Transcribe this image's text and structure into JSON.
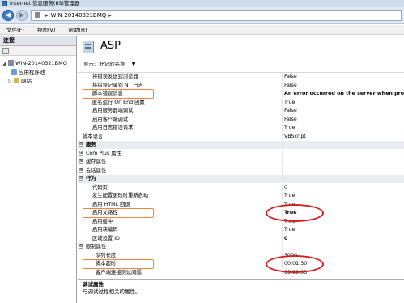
{
  "window": {
    "title": "Internet 信息服务(IIS)管理器"
  },
  "address": {
    "server": "WIN-20140321BMQ",
    "separator": "▸"
  },
  "menu": {
    "items": [
      "文件(F)",
      "视图(V)",
      "帮助(H)"
    ]
  },
  "connections": {
    "header": "连接",
    "tree": {
      "server": "WIN-20140321BMQ",
      "children": [
        "应用程序池",
        "网站"
      ]
    }
  },
  "main": {
    "title": "ASP",
    "display_label": "显示:",
    "display_value": "好记的名称"
  },
  "grid": {
    "rows": [
      {
        "name": "将错误发送到浏览器",
        "value": "False",
        "kind": "child"
      },
      {
        "name": "将错误记录到 NT 日志",
        "value": "False",
        "kind": "child"
      },
      {
        "name": "脚本错误消息",
        "value": "An error occurred on the server when proce",
        "kind": "child",
        "bold": true
      },
      {
        "name": "匿名运行 On End 函数",
        "value": "True",
        "kind": "child"
      },
      {
        "name": "启用服务器端调试",
        "value": "False",
        "kind": "child"
      },
      {
        "name": "启用客户端调试",
        "value": "False",
        "kind": "child"
      },
      {
        "name": "启用日志错误请求",
        "value": "True",
        "kind": "child"
      },
      {
        "name": "脚本语言",
        "value": "VBScript",
        "kind": "plain"
      },
      {
        "name": "服务",
        "value": "",
        "kind": "section",
        "toggle": "⊟"
      },
      {
        "name": "Com Plus 属性",
        "value": "",
        "kind": "subsection",
        "toggle": "⊞"
      },
      {
        "name": "缓存属性",
        "value": "",
        "kind": "subsection",
        "toggle": "⊞"
      },
      {
        "name": "会话属性",
        "value": "",
        "kind": "subsection",
        "toggle": "⊞"
      },
      {
        "name": "行为",
        "value": "",
        "kind": "section",
        "toggle": "⊟"
      },
      {
        "name": "代码页",
        "value": "0",
        "kind": "child"
      },
      {
        "name": "发生配置更改时重新启动",
        "value": "True",
        "kind": "child"
      },
      {
        "name": "启用 HTML 回退",
        "value": "True",
        "kind": "child"
      },
      {
        "name": "启用父路径",
        "value": "True",
        "kind": "child",
        "bold": true
      },
      {
        "name": "启用缓冲",
        "value": "True",
        "kind": "child"
      },
      {
        "name": "启用块编码",
        "value": "True",
        "kind": "child"
      },
      {
        "name": "区域设置 ID",
        "value": "0",
        "kind": "child",
        "bold": true
      },
      {
        "name": "限制属性",
        "value": "",
        "kind": "subsection",
        "toggle": "⊟"
      },
      {
        "name": "队列长度",
        "value": "3000",
        "kind": "section-child"
      },
      {
        "name": "脚本超时",
        "value": "00:01:30",
        "kind": "section-child"
      },
      {
        "name": "客户端连接测试间隔",
        "value": "00:00:03",
        "kind": "section-child"
      }
    ]
  },
  "description": {
    "title": "调试属性",
    "text": "与调试过程相关的属性。"
  },
  "colors": {
    "highlight_rect": "#f0843c",
    "highlight_oval": "#d11f1f",
    "section_bg": "#e9ecf1"
  }
}
